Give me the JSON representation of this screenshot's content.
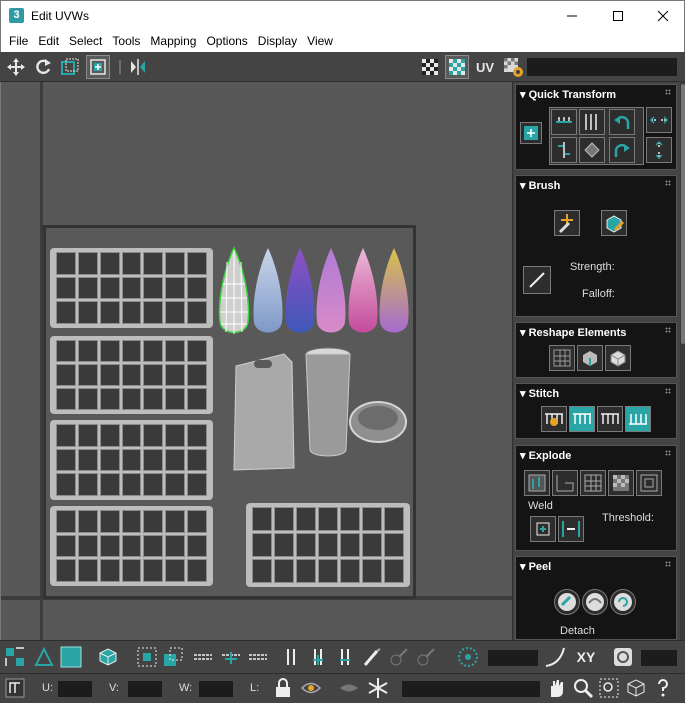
{
  "window": {
    "title": "Edit UVWs",
    "app_icon_text": "3"
  },
  "menu": [
    "File",
    "Edit",
    "Select",
    "Tools",
    "Mapping",
    "Options",
    "Display",
    "View"
  ],
  "top_toolbar": {
    "uv_label": "UV",
    "icons": [
      "move-icon",
      "rotate-icon",
      "scale-icon",
      "freeform-icon",
      "mirror-icon",
      "checker-icon",
      "checker-pattern-icon",
      "uv-options-icon"
    ]
  },
  "colors": {
    "accent": "#2aa5a5",
    "panel_bg": "#141414",
    "toolbar_bg": "#444444",
    "viewport_bg": "#585858"
  },
  "panel": {
    "quick_transform": {
      "title": "Quick Transform"
    },
    "brush": {
      "title": "Brush",
      "strength_label": "Strength:",
      "falloff_label": "Falloff:"
    },
    "reshape": {
      "title": "Reshape Elements"
    },
    "stitch": {
      "title": "Stitch"
    },
    "explode": {
      "title": "Explode",
      "weld_label": "Weld",
      "threshold_label": "Threshold:"
    },
    "peel": {
      "title": "Peel",
      "detach_label": "Detach"
    }
  },
  "bottom_toolbar": {
    "xy_label": "XY"
  },
  "status_bar": {
    "u_label": "U:",
    "v_label": "V:",
    "w_label": "W:",
    "l_label": "L:"
  }
}
